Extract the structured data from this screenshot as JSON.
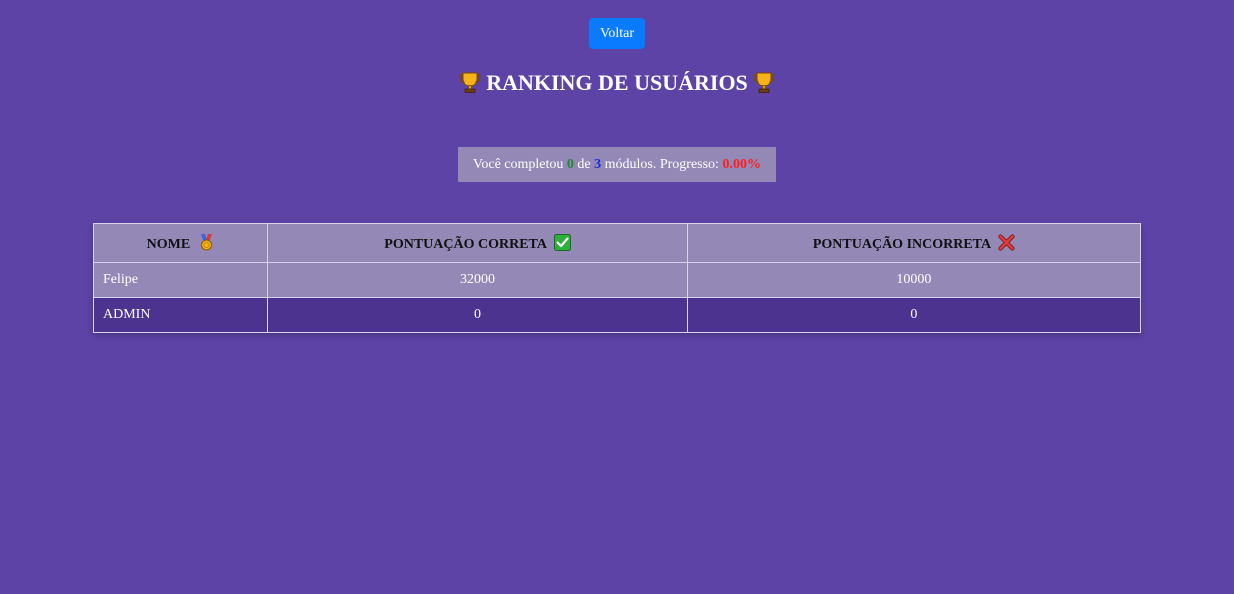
{
  "header": {
    "back_label": "Voltar",
    "title": "RANKING DE USUÁRIOS",
    "title_icon": "trophy-icon"
  },
  "progress": {
    "prefix": "Você completou",
    "completed": "0",
    "of_word": "de",
    "total": "3",
    "middle": "módulos. Progresso:",
    "percent": "0.00%",
    "colors": {
      "completed": "#1f8a2e",
      "total": "#1a2be0",
      "percent": "#ff1e1e"
    }
  },
  "table": {
    "columns": [
      {
        "label": "NOME",
        "icon": "medal-icon"
      },
      {
        "label": "PONTUAÇÃO CORRETA",
        "icon": "check-mark-icon"
      },
      {
        "label": "PONTUAÇÃO INCORRETA",
        "icon": "cross-mark-icon"
      }
    ],
    "rows": [
      {
        "name": "Felipe",
        "correct": "32000",
        "incorrect": "10000"
      },
      {
        "name": "ADMIN",
        "correct": "0",
        "incorrect": "0"
      }
    ]
  },
  "colors": {
    "background": "#5d43a6",
    "button": "#0a7bff",
    "row_light": "#9488b7",
    "row_dark": "#4b338f"
  }
}
